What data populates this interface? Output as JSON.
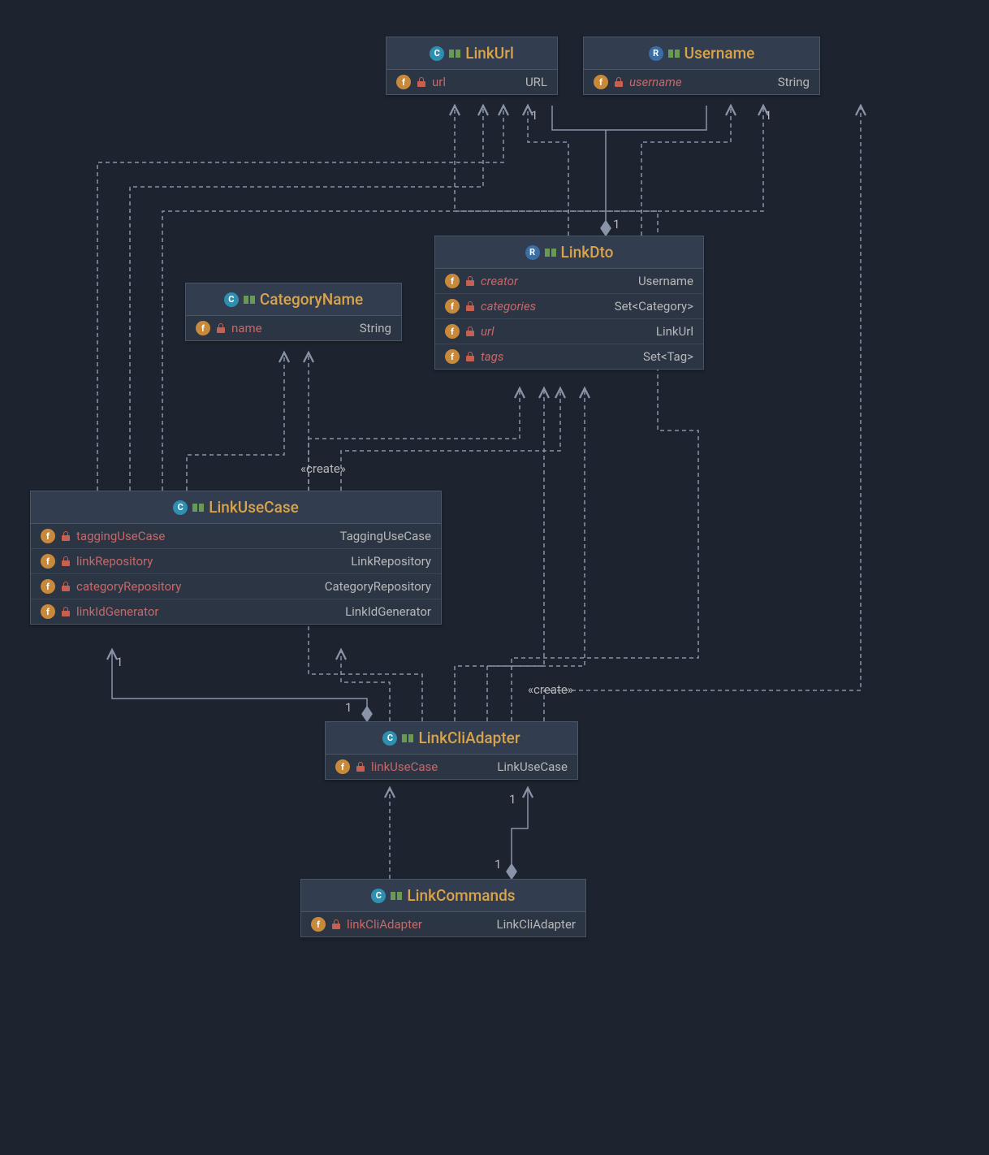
{
  "classes": {
    "linkurl": {
      "title": "LinkUrl",
      "stereotype": "C",
      "fields": [
        {
          "name": "url",
          "type": "URL",
          "italic": false
        }
      ]
    },
    "username": {
      "title": "Username",
      "stereotype": "R",
      "fields": [
        {
          "name": "username",
          "type": "String",
          "italic": true
        }
      ]
    },
    "categoryname": {
      "title": "CategoryName",
      "stereotype": "C",
      "fields": [
        {
          "name": "name",
          "type": "String",
          "italic": false
        }
      ]
    },
    "linkdto": {
      "title": "LinkDto",
      "stereotype": "R",
      "fields": [
        {
          "name": "creator",
          "type": "Username",
          "italic": true
        },
        {
          "name": "categories",
          "type": "Set<Category>",
          "italic": true
        },
        {
          "name": "url",
          "type": "LinkUrl",
          "italic": true
        },
        {
          "name": "tags",
          "type": "Set<Tag>",
          "italic": true
        }
      ]
    },
    "linkusecase": {
      "title": "LinkUseCase",
      "stereotype": "C",
      "fields": [
        {
          "name": "taggingUseCase",
          "type": "TaggingUseCase",
          "italic": false
        },
        {
          "name": "linkRepository",
          "type": "LinkRepository",
          "italic": false
        },
        {
          "name": "categoryRepository",
          "type": "CategoryRepository",
          "italic": false
        },
        {
          "name": "linkIdGenerator",
          "type": "LinkIdGenerator",
          "italic": false
        }
      ]
    },
    "linkcliadapter": {
      "title": "LinkCliAdapter",
      "stereotype": "C",
      "fields": [
        {
          "name": "linkUseCase",
          "type": "LinkUseCase",
          "italic": false
        }
      ]
    },
    "linkcommands": {
      "title": "LinkCommands",
      "stereotype": "C",
      "fields": [
        {
          "name": "linkCliAdapter",
          "type": "LinkCliAdapter",
          "italic": false
        }
      ]
    }
  },
  "labels": {
    "one_a": "1",
    "one_b": "1",
    "one_c": "1",
    "one_d": "1",
    "one_e": "1",
    "one_f": "1",
    "one_g": "1",
    "create_a": "«create»",
    "create_b": "«create»"
  }
}
